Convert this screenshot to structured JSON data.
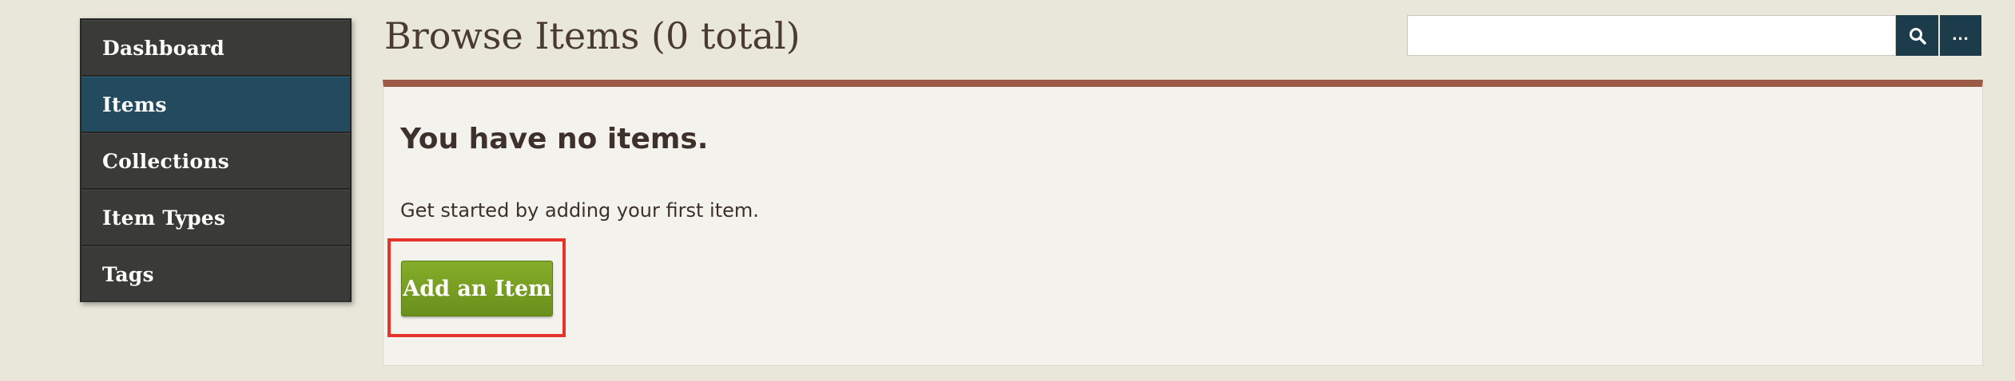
{
  "sidebar": {
    "items": [
      {
        "label": "Dashboard",
        "active": false
      },
      {
        "label": "Items",
        "active": true
      },
      {
        "label": "Collections",
        "active": false
      },
      {
        "label": "Item Types",
        "active": false
      },
      {
        "label": "Tags",
        "active": false
      }
    ]
  },
  "header": {
    "title": "Browse Items (0 total)"
  },
  "search": {
    "value": "",
    "placeholder": "",
    "submit_icon": "search-icon",
    "more_label": "..."
  },
  "main": {
    "heading": "You have no items.",
    "description": "Get started by adding your first item.",
    "add_button_label": "Add an Item"
  },
  "colors": {
    "background": "#e9e6da",
    "sidebar": "#3a3a39",
    "sidebar_active": "#234a5e",
    "panel_accent": "#9c5b47",
    "button_green": "#76a023",
    "search_button": "#1d3c4b",
    "highlight": "#e8332a"
  }
}
